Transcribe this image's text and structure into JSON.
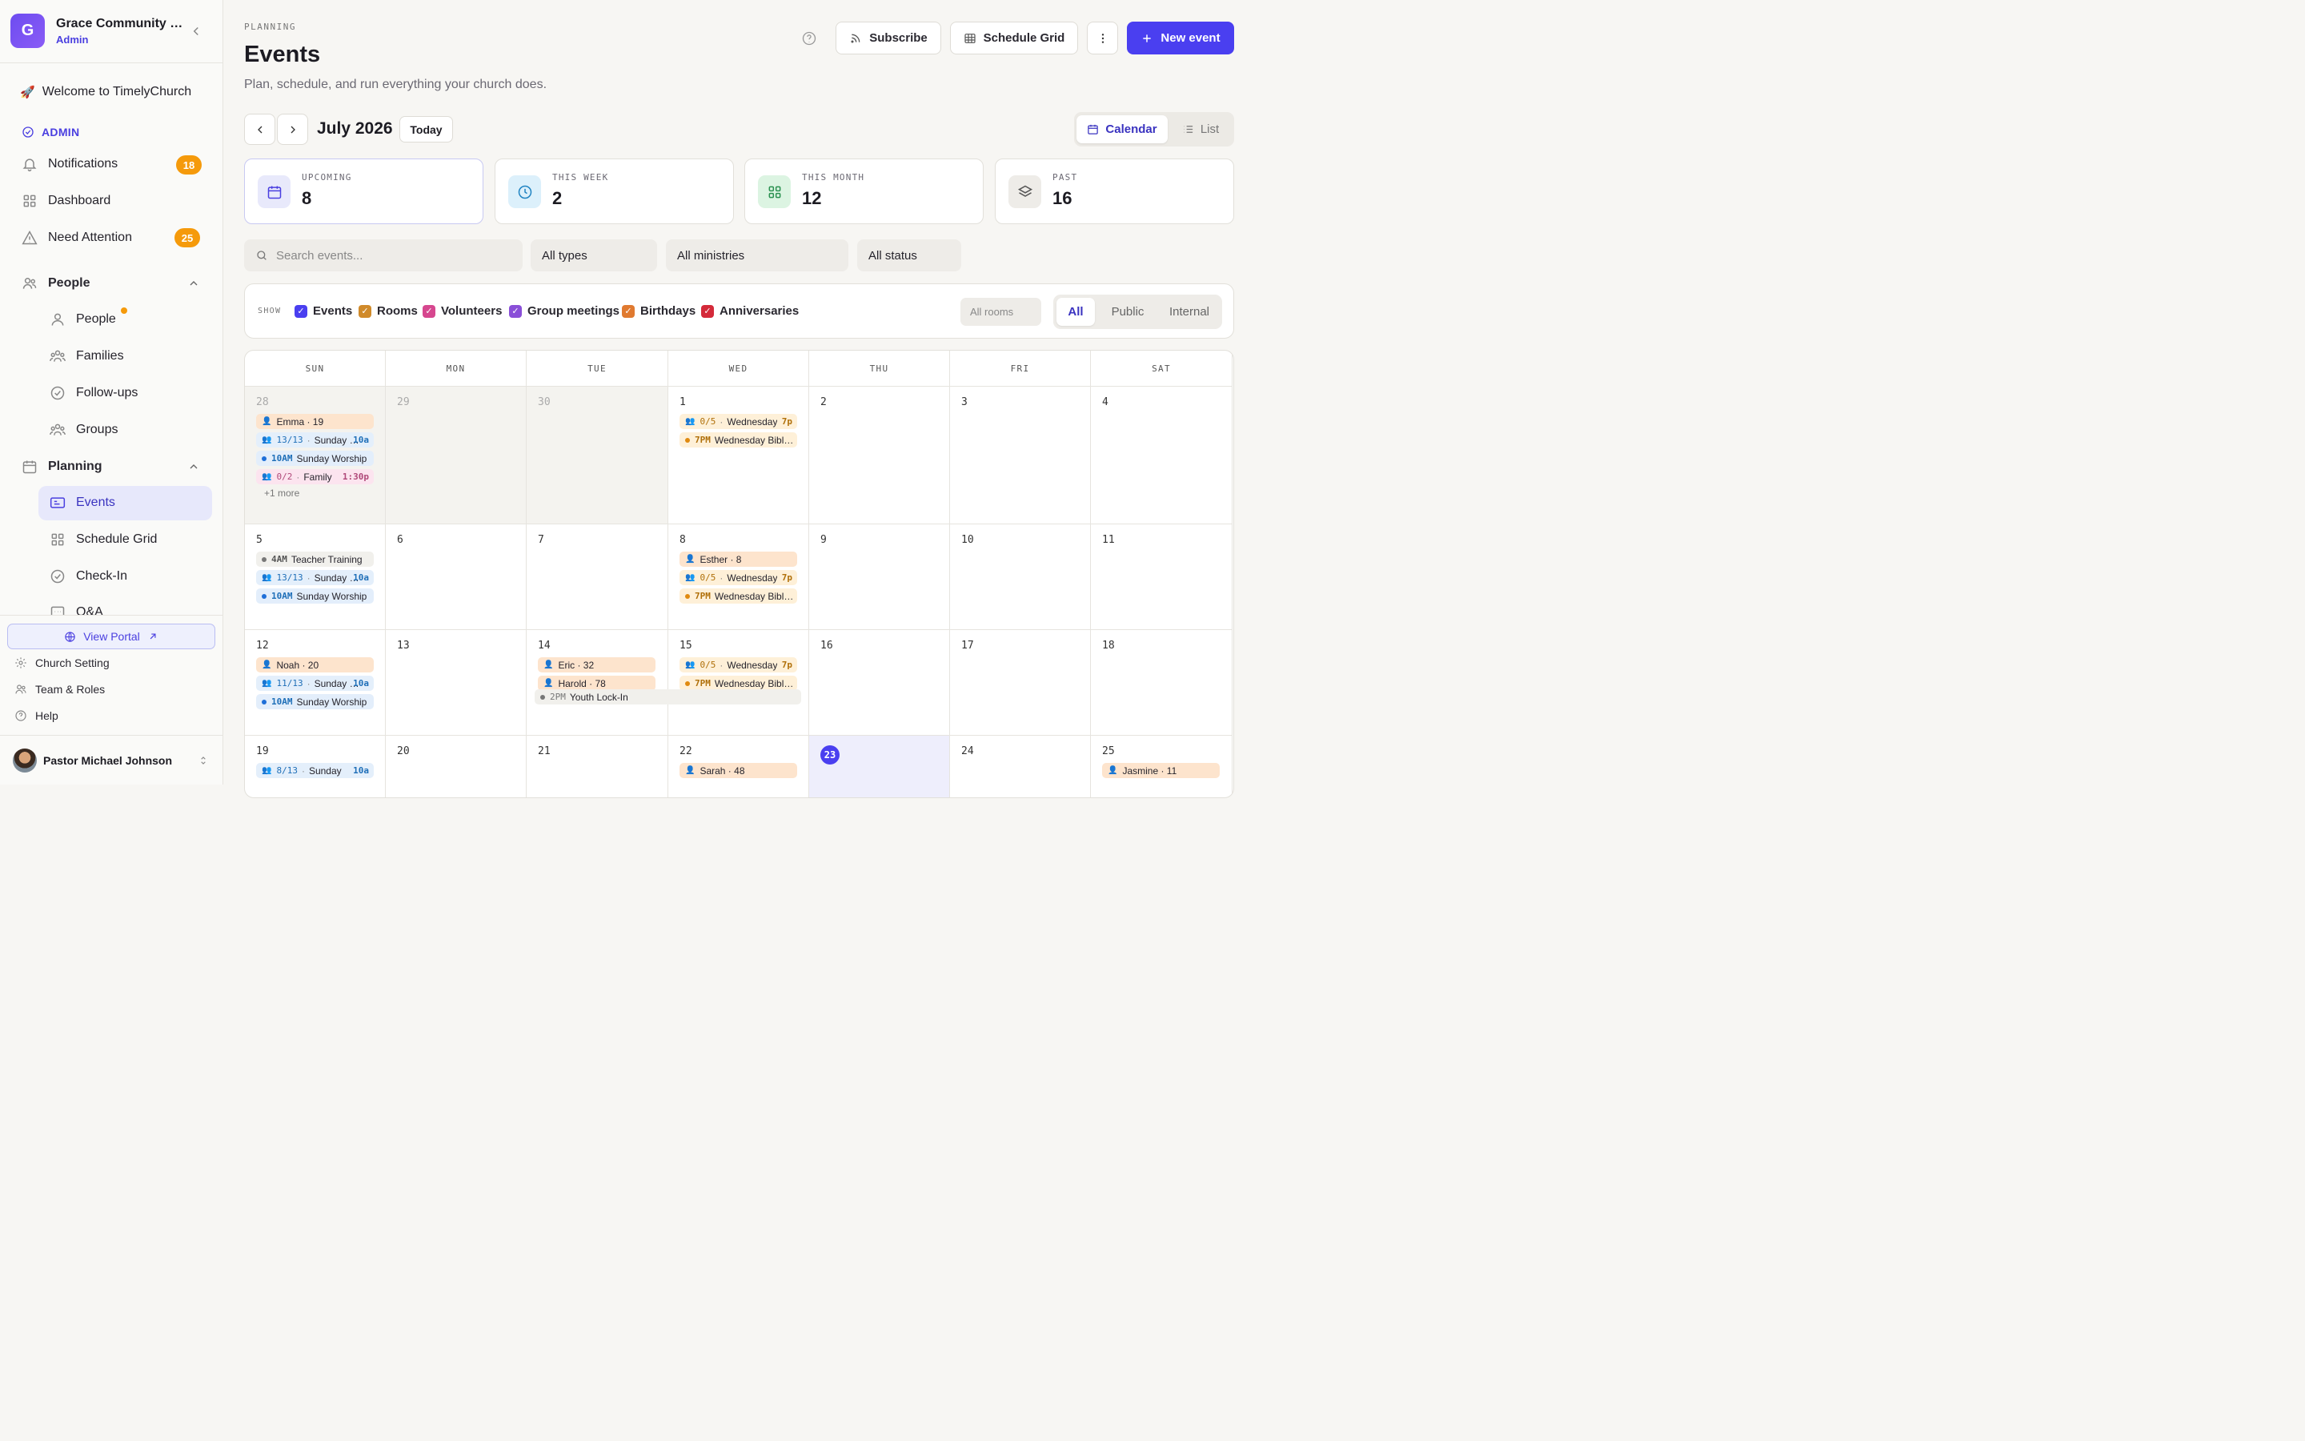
{
  "org": {
    "logo_letter": "G",
    "name": "Grace Community Church",
    "role": "Admin"
  },
  "sidebar": {
    "welcome": "Welcome to TimelyChurch",
    "admin_label": "ADMIN",
    "notifications": {
      "label": "Notifications",
      "count": "18"
    },
    "dashboard": "Dashboard",
    "need_attention": {
      "label": "Need Attention",
      "count": "25"
    },
    "people_section": "People",
    "people_items": [
      "People",
      "Families",
      "Follow-ups",
      "Groups"
    ],
    "planning_section": "Planning",
    "planning_items": [
      "Events",
      "Schedule Grid",
      "Check-In",
      "Q&A"
    ],
    "view_portal": "View Portal",
    "footer_items": [
      "Church Setting",
      "Team & Roles",
      "Help"
    ],
    "user_name": "Pastor Michael Johnson"
  },
  "header": {
    "kicker": "PLANNING",
    "title": "Events",
    "subtitle": "Plan, schedule, and run everything your church does.",
    "subscribe": "Subscribe",
    "schedule_grid": "Schedule Grid",
    "new_event": "New event"
  },
  "calendar_nav": {
    "month": "July 2026",
    "today": "Today",
    "view_calendar": "Calendar",
    "view_list": "List"
  },
  "stats": [
    {
      "label": "UPCOMING",
      "value": "8"
    },
    {
      "label": "THIS WEEK",
      "value": "2"
    },
    {
      "label": "THIS MONTH",
      "value": "12"
    },
    {
      "label": "PAST",
      "value": "16"
    }
  ],
  "filters": {
    "search_placeholder": "Search events...",
    "types": "All types",
    "ministries": "All ministries",
    "status": "All status"
  },
  "show": {
    "label": "SHOW",
    "items": [
      {
        "label": "Events",
        "color": "#4a3ff0"
      },
      {
        "label": "Rooms",
        "color": "#d08a2a"
      },
      {
        "label": "Volunteers",
        "color": "#d6478f"
      },
      {
        "label": "Group meetings",
        "color": "#8a4fd8"
      },
      {
        "label": "Birthdays",
        "color": "#e07a30"
      },
      {
        "label": "Anniversaries",
        "color": "#d42a3a"
      }
    ],
    "rooms": "All rooms",
    "audience": [
      "All",
      "Public",
      "Internal"
    ]
  },
  "weekdays": [
    "SUN",
    "MON",
    "TUE",
    "WED",
    "THU",
    "FRI",
    "SAT"
  ],
  "days": [
    [
      "28",
      "29",
      "30",
      "1",
      "2",
      "3",
      "4"
    ],
    [
      "5",
      "6",
      "7",
      "8",
      "9",
      "10",
      "11"
    ],
    [
      "12",
      "13",
      "14",
      "15",
      "16",
      "17",
      "18"
    ],
    [
      "19",
      "20",
      "21",
      "22",
      "23",
      "24",
      "25"
    ]
  ],
  "events": {
    "w0": {
      "sun": [
        {
          "name": "Emma · 19"
        },
        {
          "prefix": "13/13",
          "name": "Sunday Worship",
          "end": "10a"
        },
        {
          "prefix": "10AM",
          "name": "Sunday Worship"
        },
        {
          "prefix": "0/2",
          "name": "Family",
          "end": "1:30p"
        }
      ],
      "sun_more": "+1 more",
      "wed": [
        {
          "prefix": "0/5",
          "name": "Wednesday",
          "end": "7p"
        },
        {
          "prefix": "7PM",
          "name": "Wednesday Bible Study"
        }
      ]
    },
    "w1": {
      "sun": [
        {
          "prefix": "4AM",
          "name": "Teacher Training"
        },
        {
          "prefix": "13/13",
          "name": "Sunday Worship",
          "end": "10a"
        },
        {
          "prefix": "10AM",
          "name": "Sunday Worship"
        }
      ],
      "wed": [
        {
          "name": "Esther · 8"
        },
        {
          "prefix": "0/5",
          "name": "Wednesday",
          "end": "7p"
        },
        {
          "prefix": "7PM",
          "name": "Wednesday Bible Study"
        }
      ]
    },
    "w2": {
      "sun": [
        {
          "name": "Noah · 20"
        },
        {
          "prefix": "11/13",
          "name": "Sunday Worship",
          "end": "10a"
        },
        {
          "prefix": "10AM",
          "name": "Sunday Worship"
        }
      ],
      "tue": [
        {
          "name": "Eric · 32"
        },
        {
          "name": "Harold · 78"
        }
      ],
      "lockin": {
        "prefix": "2PM",
        "name": "Youth Lock-In"
      },
      "wed": [
        {
          "prefix": "0/5",
          "name": "Wednesday",
          "end": "7p"
        },
        {
          "prefix": "7PM",
          "name": "Wednesday Bible Study"
        }
      ]
    },
    "w3": {
      "sun": [
        {
          "prefix": "8/13",
          "name": "Sunday",
          "end": "10a"
        }
      ],
      "wed": [
        {
          "name": "Sarah · 48"
        }
      ],
      "sat": [
        {
          "name": "Jasmine · 11"
        }
      ]
    }
  }
}
